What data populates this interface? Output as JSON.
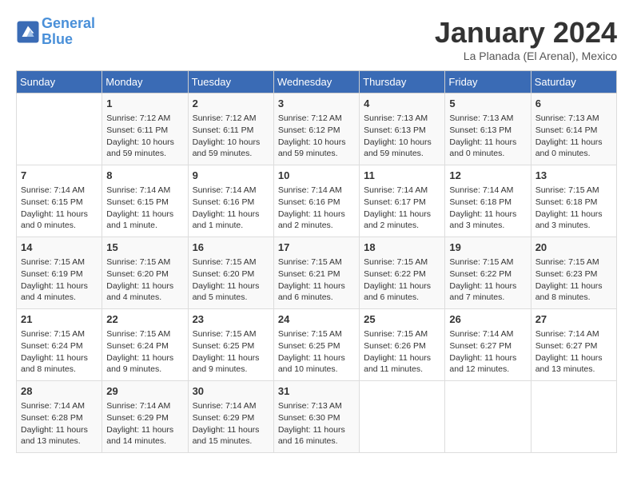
{
  "logo": {
    "line1": "General",
    "line2": "Blue"
  },
  "title": "January 2024",
  "location": "La Planada (El Arenal), Mexico",
  "weekdays": [
    "Sunday",
    "Monday",
    "Tuesday",
    "Wednesday",
    "Thursday",
    "Friday",
    "Saturday"
  ],
  "weeks": [
    [
      {
        "day": "",
        "info": ""
      },
      {
        "day": "1",
        "info": "Sunrise: 7:12 AM\nSunset: 6:11 PM\nDaylight: 10 hours\nand 59 minutes."
      },
      {
        "day": "2",
        "info": "Sunrise: 7:12 AM\nSunset: 6:11 PM\nDaylight: 10 hours\nand 59 minutes."
      },
      {
        "day": "3",
        "info": "Sunrise: 7:12 AM\nSunset: 6:12 PM\nDaylight: 10 hours\nand 59 minutes."
      },
      {
        "day": "4",
        "info": "Sunrise: 7:13 AM\nSunset: 6:13 PM\nDaylight: 10 hours\nand 59 minutes."
      },
      {
        "day": "5",
        "info": "Sunrise: 7:13 AM\nSunset: 6:13 PM\nDaylight: 11 hours\nand 0 minutes."
      },
      {
        "day": "6",
        "info": "Sunrise: 7:13 AM\nSunset: 6:14 PM\nDaylight: 11 hours\nand 0 minutes."
      }
    ],
    [
      {
        "day": "7",
        "info": "Sunrise: 7:14 AM\nSunset: 6:15 PM\nDaylight: 11 hours\nand 0 minutes."
      },
      {
        "day": "8",
        "info": "Sunrise: 7:14 AM\nSunset: 6:15 PM\nDaylight: 11 hours\nand 1 minute."
      },
      {
        "day": "9",
        "info": "Sunrise: 7:14 AM\nSunset: 6:16 PM\nDaylight: 11 hours\nand 1 minute."
      },
      {
        "day": "10",
        "info": "Sunrise: 7:14 AM\nSunset: 6:16 PM\nDaylight: 11 hours\nand 2 minutes."
      },
      {
        "day": "11",
        "info": "Sunrise: 7:14 AM\nSunset: 6:17 PM\nDaylight: 11 hours\nand 2 minutes."
      },
      {
        "day": "12",
        "info": "Sunrise: 7:14 AM\nSunset: 6:18 PM\nDaylight: 11 hours\nand 3 minutes."
      },
      {
        "day": "13",
        "info": "Sunrise: 7:15 AM\nSunset: 6:18 PM\nDaylight: 11 hours\nand 3 minutes."
      }
    ],
    [
      {
        "day": "14",
        "info": "Sunrise: 7:15 AM\nSunset: 6:19 PM\nDaylight: 11 hours\nand 4 minutes."
      },
      {
        "day": "15",
        "info": "Sunrise: 7:15 AM\nSunset: 6:20 PM\nDaylight: 11 hours\nand 4 minutes."
      },
      {
        "day": "16",
        "info": "Sunrise: 7:15 AM\nSunset: 6:20 PM\nDaylight: 11 hours\nand 5 minutes."
      },
      {
        "day": "17",
        "info": "Sunrise: 7:15 AM\nSunset: 6:21 PM\nDaylight: 11 hours\nand 6 minutes."
      },
      {
        "day": "18",
        "info": "Sunrise: 7:15 AM\nSunset: 6:22 PM\nDaylight: 11 hours\nand 6 minutes."
      },
      {
        "day": "19",
        "info": "Sunrise: 7:15 AM\nSunset: 6:22 PM\nDaylight: 11 hours\nand 7 minutes."
      },
      {
        "day": "20",
        "info": "Sunrise: 7:15 AM\nSunset: 6:23 PM\nDaylight: 11 hours\nand 8 minutes."
      }
    ],
    [
      {
        "day": "21",
        "info": "Sunrise: 7:15 AM\nSunset: 6:24 PM\nDaylight: 11 hours\nand 8 minutes."
      },
      {
        "day": "22",
        "info": "Sunrise: 7:15 AM\nSunset: 6:24 PM\nDaylight: 11 hours\nand 9 minutes."
      },
      {
        "day": "23",
        "info": "Sunrise: 7:15 AM\nSunset: 6:25 PM\nDaylight: 11 hours\nand 9 minutes."
      },
      {
        "day": "24",
        "info": "Sunrise: 7:15 AM\nSunset: 6:25 PM\nDaylight: 11 hours\nand 10 minutes."
      },
      {
        "day": "25",
        "info": "Sunrise: 7:15 AM\nSunset: 6:26 PM\nDaylight: 11 hours\nand 11 minutes."
      },
      {
        "day": "26",
        "info": "Sunrise: 7:14 AM\nSunset: 6:27 PM\nDaylight: 11 hours\nand 12 minutes."
      },
      {
        "day": "27",
        "info": "Sunrise: 7:14 AM\nSunset: 6:27 PM\nDaylight: 11 hours\nand 13 minutes."
      }
    ],
    [
      {
        "day": "28",
        "info": "Sunrise: 7:14 AM\nSunset: 6:28 PM\nDaylight: 11 hours\nand 13 minutes."
      },
      {
        "day": "29",
        "info": "Sunrise: 7:14 AM\nSunset: 6:29 PM\nDaylight: 11 hours\nand 14 minutes."
      },
      {
        "day": "30",
        "info": "Sunrise: 7:14 AM\nSunset: 6:29 PM\nDaylight: 11 hours\nand 15 minutes."
      },
      {
        "day": "31",
        "info": "Sunrise: 7:13 AM\nSunset: 6:30 PM\nDaylight: 11 hours\nand 16 minutes."
      },
      {
        "day": "",
        "info": ""
      },
      {
        "day": "",
        "info": ""
      },
      {
        "day": "",
        "info": ""
      }
    ]
  ]
}
